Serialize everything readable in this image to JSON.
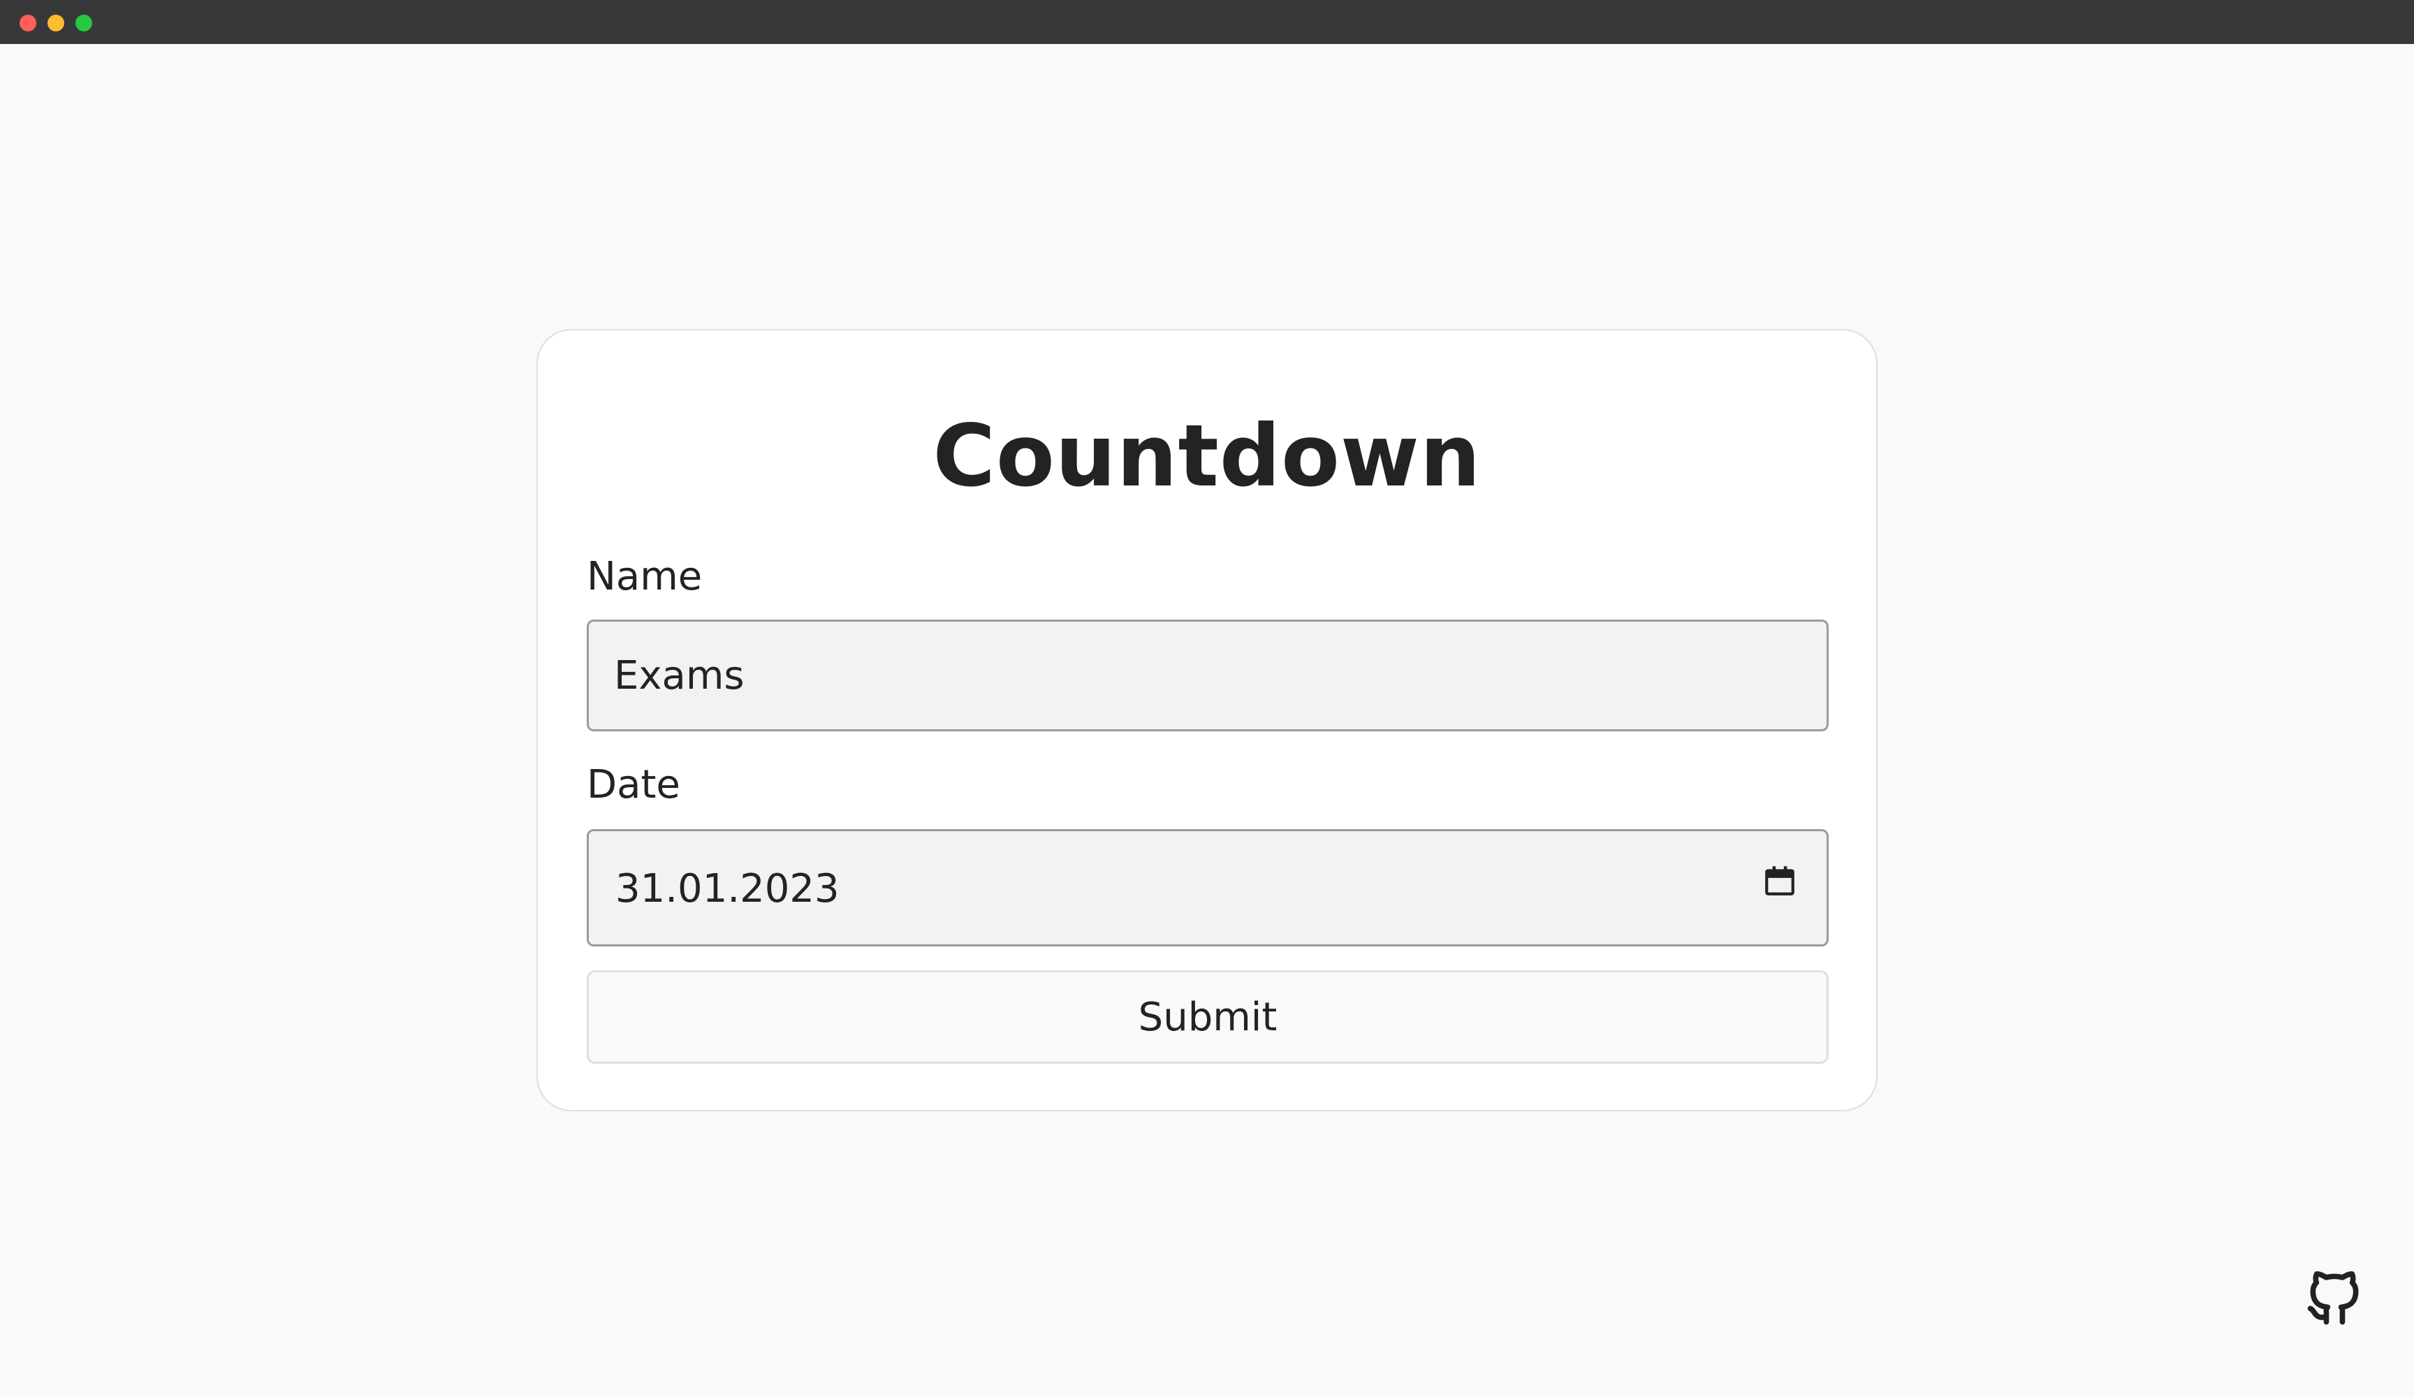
{
  "window": {
    "controls": [
      "close",
      "minimize",
      "zoom"
    ]
  },
  "form": {
    "title": "Countdown",
    "name_label": "Name",
    "name_value": "Exams",
    "date_label": "Date",
    "date_value": "31.01.2023",
    "submit_label": "Submit"
  },
  "icons": {
    "calendar": "calendar-icon",
    "github": "github-icon"
  },
  "colors": {
    "titlebar": "#37383a",
    "page_background": "#f8f9f8",
    "card_background": "#ffffff",
    "input_background": "#f2f2f4",
    "text": "#212324"
  }
}
